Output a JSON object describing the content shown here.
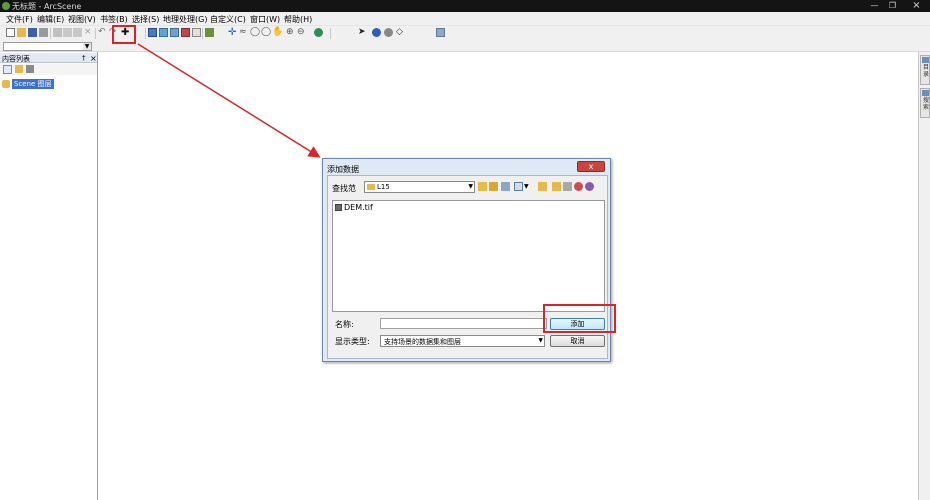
{
  "window": {
    "title": "无标题 - ArcScene",
    "minimize_icon": "minimize-icon",
    "maximize_icon": "maximize-icon",
    "close_icon": "close-icon"
  },
  "menus": [
    "文件(F)",
    "编辑(E)",
    "视图(V)",
    "书签(B)",
    "选择(S)",
    "地理处理(G)",
    "自定义(C)",
    "窗口(W)",
    "帮助(H)"
  ],
  "toolbar_icons": [
    "new-icon",
    "open-icon",
    "save-icon",
    "print-icon",
    "cut-icon",
    "copy-icon",
    "paste-icon",
    "delete-icon",
    "undo-icon",
    "redo-icon",
    "add-data-icon",
    "layer-properties-icon",
    "scene-properties-icon",
    "table-icon",
    "layout-icon",
    "graph-icon",
    "model-icon",
    "navigate-icon",
    "fly-icon",
    "zoom-in-icon",
    "zoom-out-icon",
    "pan-icon",
    "full-extent-icon",
    "globe-icon",
    "select-icon",
    "identify-icon",
    "find-icon",
    "measure-icon",
    "animation-icon"
  ],
  "toc": {
    "title": "内容列表",
    "pin_icon": "pin-icon",
    "close_icon": "close-icon",
    "layer": "Scene 图层"
  },
  "right_dock": [
    {
      "label": "目录",
      "icon": "catalog-icon"
    },
    {
      "label": "搜索",
      "icon": "search-icon"
    }
  ],
  "dialog": {
    "title": "添加数据",
    "close_label": "x",
    "look_in_label": "查找范",
    "look_in_value": "L15",
    "files": [
      "DEM.tif"
    ],
    "name_label": "名称:",
    "name_value": "",
    "type_label": "显示类型:",
    "type_value": "支持场景的数据集和图层",
    "add_label": "添加",
    "cancel_label": "取消"
  },
  "colors": {
    "highlight": "#d8252b",
    "selection": "#3b6fd0"
  }
}
